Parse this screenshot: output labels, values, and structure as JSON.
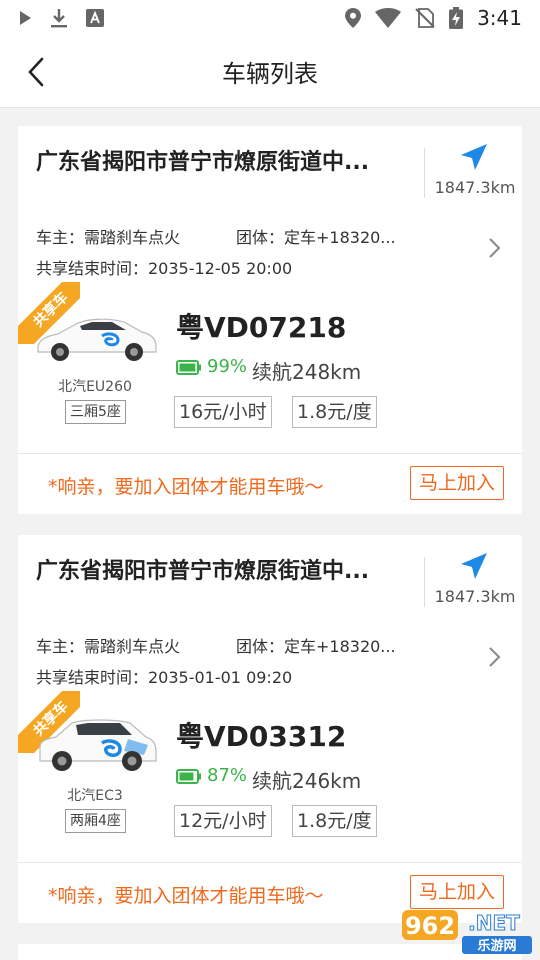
{
  "status_bar": {
    "time": "3:41",
    "icons_left": [
      "play-icon",
      "download-icon",
      "a-icon"
    ],
    "icons_right": [
      "location-icon",
      "wifi-icon",
      "no-sim-icon",
      "battery-charging-icon"
    ]
  },
  "nav": {
    "title": "车辆列表",
    "back_icon": "chevron-left-icon"
  },
  "colors": {
    "accent_orange": "#f06a1e",
    "ribbon_orange": "#f5a623",
    "battery_green": "#3bb54a",
    "location_blue": "#1e88e5"
  },
  "vehicles": [
    {
      "address": "广东省揭阳市普宁市燎原街道中...",
      "distance": "1847.3km",
      "owner": "车主：需踏刹车点火",
      "group": "团体：定车+18320...",
      "end_time": "共享结束时间：2035-12-05 20:00",
      "ribbon": "共享车",
      "model": "北汽EU260",
      "seat": "三厢5座",
      "plate": "粤VD07218",
      "battery_pct": "99%",
      "battery_level": 0.99,
      "range": "续航248km",
      "price_hour": "16元/小时",
      "price_kwh": "1.8元/度",
      "promo": "*响亲，要加入团体才能用车哦～",
      "join_label": "马上加入"
    },
    {
      "address": "广东省揭阳市普宁市燎原街道中...",
      "distance": "1847.3km",
      "owner": "车主：需踏刹车点火",
      "group": "团体：定车+18320...",
      "end_time": "共享结束时间：2035-01-01 09:20",
      "ribbon": "共享车",
      "model": "北汽EC3",
      "seat": "两厢4座",
      "plate": "粤VD03312",
      "battery_pct": "87%",
      "battery_level": 0.87,
      "range": "续航246km",
      "price_hour": "12元/小时",
      "price_kwh": "1.8元/度",
      "promo": "*响亲，要加入团体才能用车哦～",
      "join_label": "马上加入"
    }
  ],
  "watermark": {
    "text_top": "962",
    "text_net": ".NET",
    "text_bottom": "乐游网"
  }
}
